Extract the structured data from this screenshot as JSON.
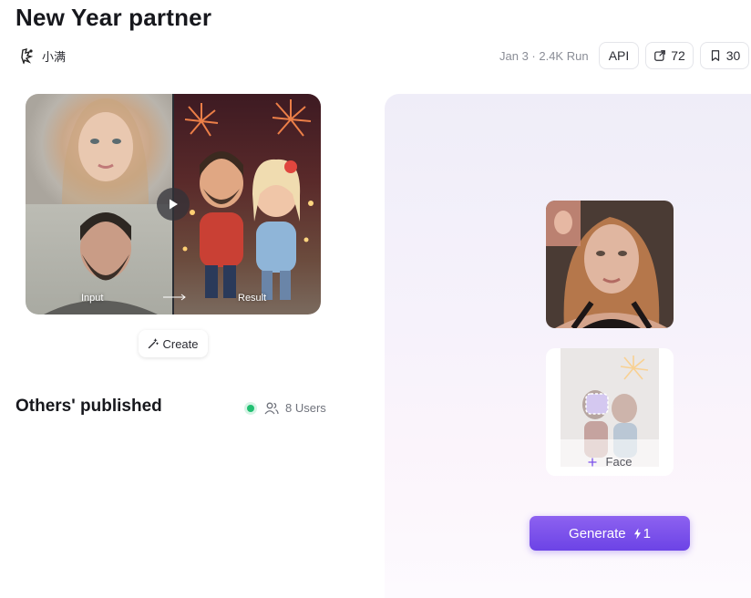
{
  "page": {
    "title": "New Year partner"
  },
  "author": {
    "name": "小满"
  },
  "meta": {
    "date_runs": "Jan 3 · 2.4K Run"
  },
  "actions": {
    "api_label": "API",
    "share_count": "72",
    "bookmark_count": "30"
  },
  "demo": {
    "input_label": "Input",
    "result_label": "Result"
  },
  "create": {
    "label": "Create"
  },
  "others": {
    "title": "Others' published",
    "users_label": "8 Users"
  },
  "face": {
    "label": "Face"
  },
  "generate": {
    "label": "Generate",
    "cost": "1"
  },
  "colors": {
    "accent": "#7b50ea",
    "online": "#22c072"
  }
}
